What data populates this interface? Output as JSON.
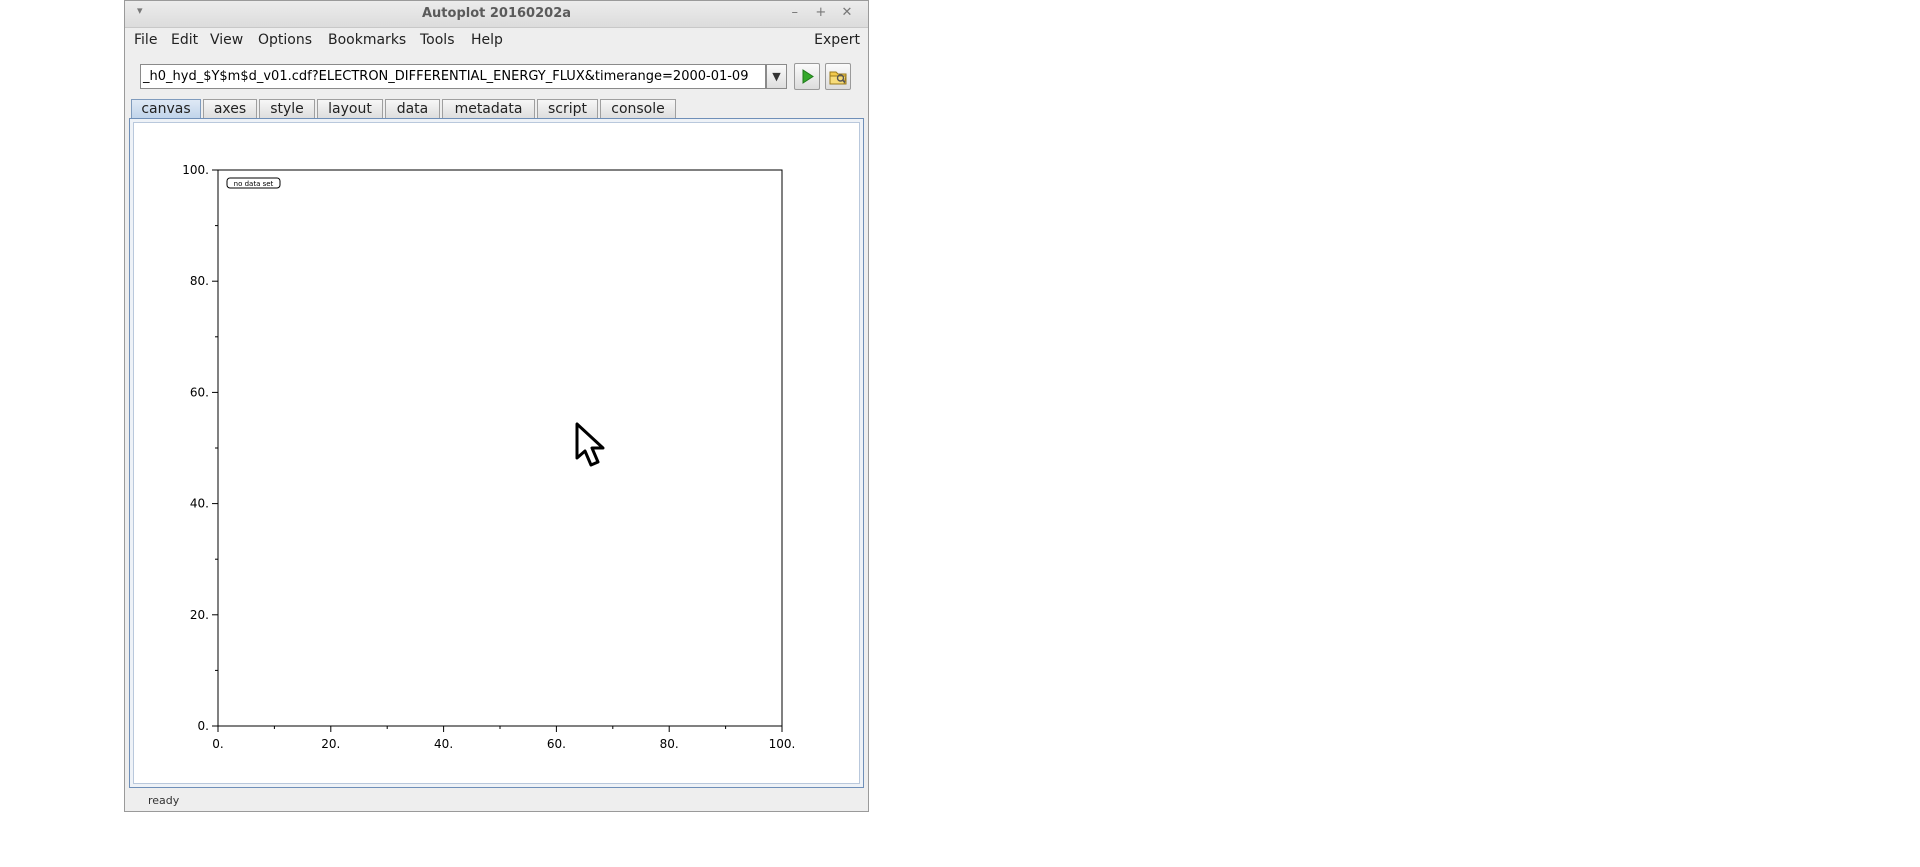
{
  "window": {
    "title": "Autoplot 20160202a",
    "menu_glyph": "▾",
    "minimize_glyph": "–",
    "maximize_glyph": "+",
    "close_glyph": "✕"
  },
  "menu": {
    "items": [
      "File",
      "Edit",
      "View",
      "Options",
      "Bookmarks",
      "Tools",
      "Help"
    ],
    "expert": "Expert"
  },
  "address": {
    "value": "_h0_hyd_$Y$m$d_v01.cdf?ELECTRON_DIFFERENTIAL_ENERGY_FLUX&timerange=2000-01-09",
    "dropdown_glyph": "▼"
  },
  "toolbar": {
    "go_icon": "green-play-icon",
    "browse_icon": "folder-open-icon"
  },
  "tabs": {
    "items": [
      "canvas",
      "axes",
      "style",
      "layout",
      "data",
      "metadata",
      "script",
      "console"
    ],
    "active": "canvas"
  },
  "plot": {
    "no_data_label": "no data set",
    "x_ticks": [
      "0.",
      "20.",
      "40.",
      "60.",
      "80.",
      "100."
    ],
    "y_ticks": [
      "0.",
      "20.",
      "40.",
      "60.",
      "80.",
      "100."
    ]
  },
  "status": {
    "text": "ready"
  }
}
